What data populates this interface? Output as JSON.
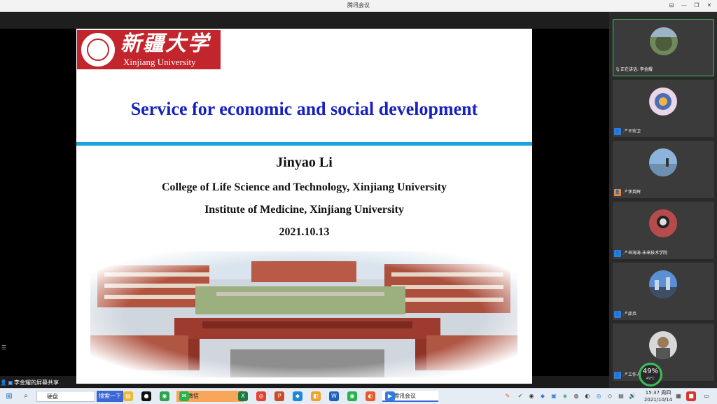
{
  "window": {
    "title": "腾讯会议",
    "minimize": "—",
    "maximize": "□",
    "restore": "❐",
    "close": "✕"
  },
  "slide": {
    "logo_cn": "新疆大学",
    "logo_en": "Xinjiang University",
    "title": "Service for economic and social development",
    "author": "Jinyao Li",
    "affiliation1": "College of Life Science and Technology, Xinjiang University",
    "affiliation2": "Institute of Medicine, Xinjiang University",
    "date": "2021.10.13",
    "title_color": "#1622c0",
    "rule_color": "#1aa3e0",
    "logo_color": "#c3252c"
  },
  "share_status": {
    "text": "李金耀的屏幕共享"
  },
  "participants": [
    {
      "label": "正在讲话: 李金耀",
      "active": true
    },
    {
      "label": "王宏卫",
      "active": false
    },
    {
      "label": "李英辉",
      "active": false
    },
    {
      "label": "岳海涛-未来技术学院",
      "active": false
    },
    {
      "label": "邵兵",
      "active": false
    },
    {
      "label": "工作人员",
      "active": false
    }
  ],
  "network": {
    "percent": "49%",
    "temp": "49°C"
  },
  "taskbar": {
    "search_label": "硬盘",
    "baidu": "搜索一下",
    "wechat": "微信",
    "meeting": "腾讯会议",
    "time": "15:37 周四",
    "date": "2021/10/14",
    "active_color": "#3b66d6"
  }
}
